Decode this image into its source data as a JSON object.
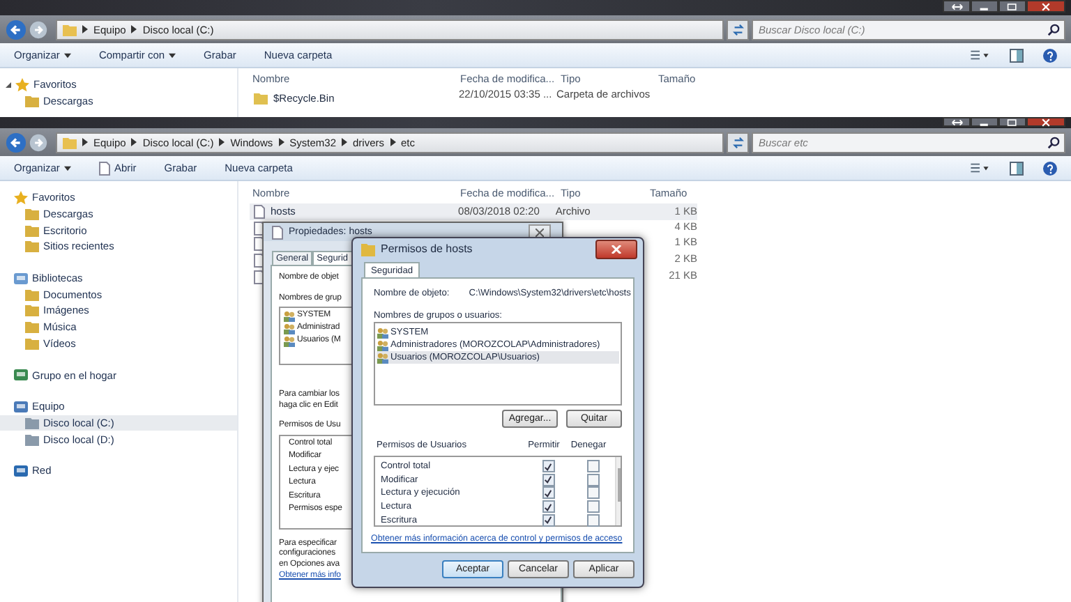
{
  "back_window": {
    "address": [
      "Equipo",
      "Disco local (C:)"
    ],
    "search": {
      "placeholder": "Buscar Disco local (C:)"
    },
    "toolbar": [
      {
        "label": "Organizar",
        "menu": true
      },
      {
        "label": "Compartir con",
        "menu": true
      },
      {
        "label": "Grabar",
        "menu": false
      },
      {
        "label": "Nueva carpeta",
        "menu": false
      }
    ],
    "sidebar": [
      {
        "label": "Favoritos",
        "expanded": true,
        "children": [
          {
            "label": "Descargas",
            "selected": false
          }
        ]
      }
    ],
    "columns": [
      "Nombre",
      "Fecha de modifica...",
      "Tipo",
      "Tamaño"
    ],
    "rows": [
      {
        "name": "$Recycle.Bin",
        "date": "22/10/2015 03:35 ...",
        "type": "Carpeta de archivos",
        "selected": false
      }
    ]
  },
  "front_window": {
    "address": [
      "Equipo",
      "Disco local (C:)",
      "Windows",
      "System32",
      "drivers",
      "etc"
    ],
    "search": {
      "placeholder": "Buscar etc"
    },
    "toolbar": [
      {
        "label": "Organizar",
        "menu": true
      },
      {
        "label": "Abrir",
        "menu": false
      },
      {
        "label": "Grabar",
        "menu": false
      },
      {
        "label": "Nueva carpeta",
        "menu": false
      }
    ],
    "sidebar": [
      {
        "label": "Favoritos",
        "children": [
          {
            "label": "Descargas",
            "selected": false
          },
          {
            "label": "Escritorio",
            "selected": false
          },
          {
            "label": "Sitios recientes",
            "selected": false
          }
        ]
      },
      {
        "label": "Bibliotecas",
        "children": [
          {
            "label": "Documentos",
            "selected": false
          },
          {
            "label": "Imágenes",
            "selected": false
          },
          {
            "label": "Música",
            "selected": false
          },
          {
            "label": "Vídeos",
            "selected": false
          }
        ]
      },
      {
        "label": "Grupo en el hogar"
      },
      {
        "label": "Equipo",
        "children": [
          {
            "label": "Disco local (C:)",
            "selected": true
          },
          {
            "label": "Disco local (D:)",
            "selected": false
          }
        ]
      },
      {
        "label": "Red"
      }
    ],
    "columns": [
      "Nombre",
      "Fecha de modifica...",
      "Tipo",
      "Tamaño"
    ],
    "rows": [
      {
        "name": "hosts",
        "date": "08/03/2018 02:20",
        "type": "Archivo",
        "size": "1 KB",
        "selected": true
      },
      {
        "size": "4 KB",
        "selected": false
      },
      {
        "size": "1 KB",
        "selected": false
      },
      {
        "size": "2 KB",
        "selected": false
      },
      {
        "size": "21 KB",
        "selected": false
      }
    ]
  },
  "properties_window": {
    "title": "Propiedades: hosts",
    "tabs": [
      {
        "label": "General",
        "selected": false
      },
      {
        "label": "Segurid",
        "selected": true
      }
    ],
    "object_label": "Nombre de objet",
    "groups_label": "Nombres de grup",
    "users": [
      "SYSTEM",
      "Administrad",
      "Usuarios (M"
    ],
    "edit_note": [
      "Para cambiar los",
      "haga clic en Edit"
    ],
    "permissions_label": "Permisos de Usu",
    "permissions": [
      "Control total",
      "Modificar",
      "Lectura y ejec",
      "Lectura",
      "Escritura",
      "Permisos espe"
    ],
    "advanced_note": [
      "Para especificar",
      "configuraciones",
      "en Opciones ava"
    ],
    "link": "Obtener más info"
  },
  "dialog": {
    "title": "Permisos de hosts",
    "tabs": [
      {
        "label": "Seguridad",
        "selected": true
      }
    ],
    "object_label": "Nombre de objeto:",
    "object_path": "C:\\Windows\\System32\\drivers\\etc\\hosts",
    "groups_label": "Nombres de grupos o usuarios:",
    "users": [
      {
        "name": "SYSTEM",
        "selected": false
      },
      {
        "name": "Administradores (MOROZCOLAP\\Administradores)",
        "selected": false
      },
      {
        "name": "Usuarios (MOROZCOLAP\\Usuarios)",
        "selected": true
      }
    ],
    "user_buttons": [
      "Agregar...",
      "Quitar"
    ],
    "permissions_label": "Permisos de Usuarios",
    "allow_label": "Permitir",
    "deny_label": "Denegar",
    "permissions": [
      {
        "name": "Control total",
        "allow": true,
        "deny": false
      },
      {
        "name": "Modificar",
        "allow": true,
        "deny": false
      },
      {
        "name": "Lectura y ejecución",
        "allow": true,
        "deny": false
      },
      {
        "name": "Lectura",
        "allow": true,
        "deny": false
      },
      {
        "name": "Escritura",
        "allow": true,
        "deny": false
      }
    ],
    "link": "Obtener más información acerca de control y permisos de acceso",
    "buttons": [
      "Aceptar",
      "Cancelar",
      "Aplicar"
    ]
  }
}
